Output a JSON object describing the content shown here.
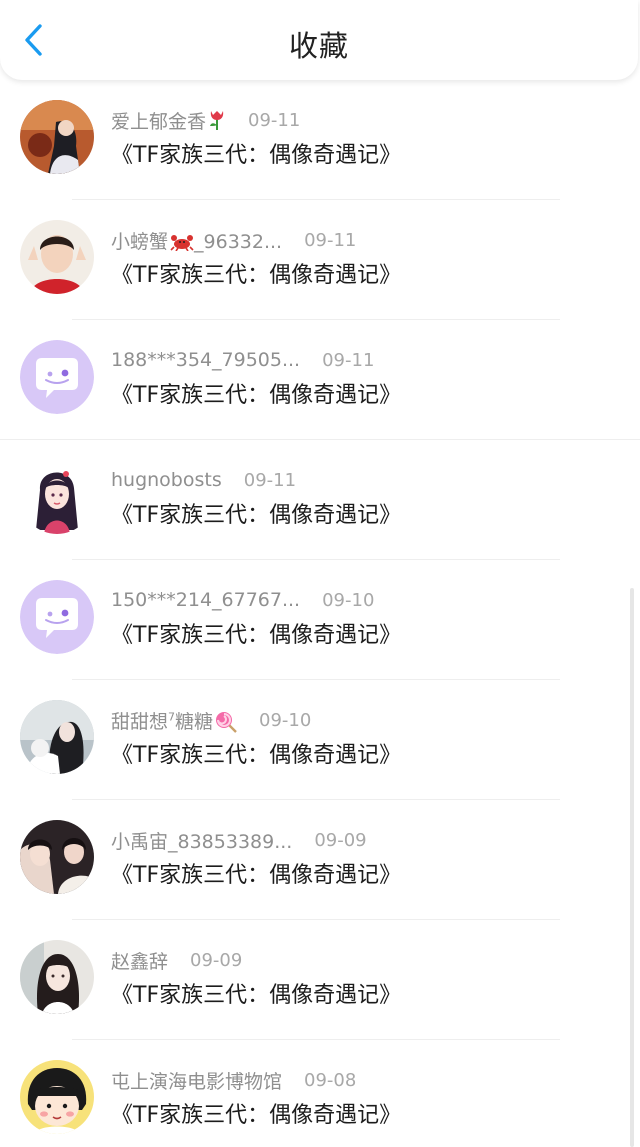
{
  "header": {
    "title": "收藏",
    "back_icon": "chevron-left-icon",
    "accent_color": "#1a9bf0"
  },
  "favorites": [
    {
      "user": "爱上郁金香",
      "badge": "tulip-icon",
      "date": "09-11",
      "title": "《TF家族三代：偶像奇遇记》"
    },
    {
      "user": "小螃蟹",
      "badge": "crab-icon",
      "user_suffix": "_96332...",
      "date": "09-11",
      "title": "《TF家族三代：偶像奇遇记》"
    },
    {
      "user": "188***354_79505...",
      "date": "09-11",
      "title": "《TF家族三代：偶像奇遇记》",
      "avatar": "default-chat-avatar"
    },
    {
      "user": "hugnobosts",
      "date": "09-11",
      "title": "《TF家族三代：偶像奇遇记》"
    },
    {
      "user": "150***214_67767...",
      "date": "09-10",
      "title": "《TF家族三代：偶像奇遇记》",
      "avatar": "default-chat-avatar"
    },
    {
      "user": "甜甜想",
      "user_sup": "7",
      "user_suffix": "糖糖",
      "badge": "lollipop-icon",
      "date": "09-10",
      "title": "《TF家族三代：偶像奇遇记》"
    },
    {
      "user": "小禹宙_83853389...",
      "date": "09-09",
      "title": "《TF家族三代：偶像奇遇记》"
    },
    {
      "user": "赵鑫辞",
      "date": "09-09",
      "title": "《TF家族三代：偶像奇遇记》"
    },
    {
      "user": "屯上演海电影博物馆",
      "date": "09-08",
      "title": "《TF家族三代：偶像奇遇记》"
    }
  ]
}
